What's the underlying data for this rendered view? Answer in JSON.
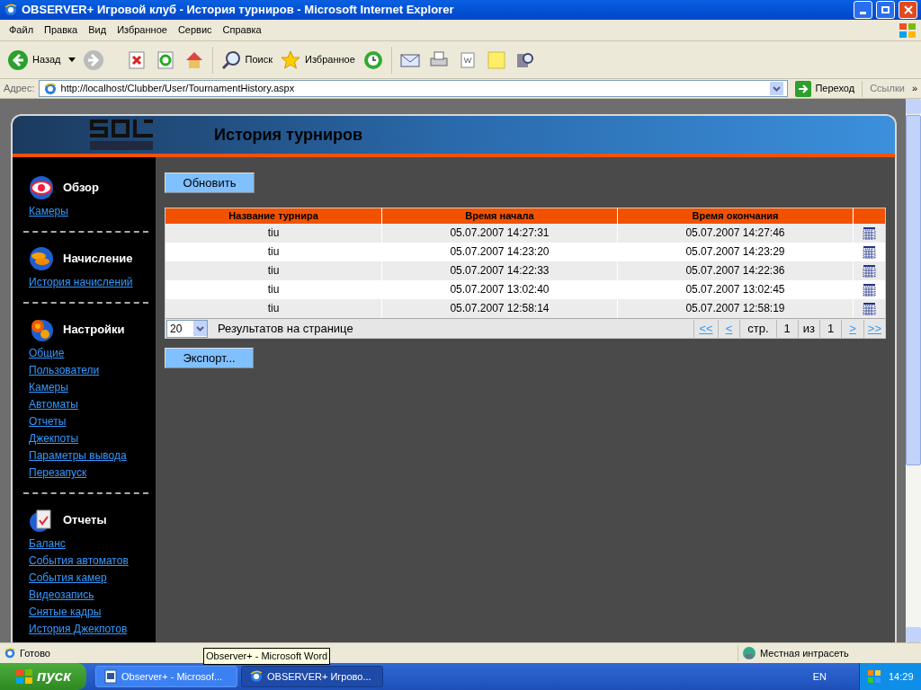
{
  "window": {
    "title": "OBSERVER+ Игровой клуб - История турниров - Microsoft Internet Explorer"
  },
  "menu": [
    "Файл",
    "Правка",
    "Вид",
    "Избранное",
    "Сервис",
    "Справка"
  ],
  "toolbar": {
    "back": "Назад",
    "search": "Поиск",
    "favorites": "Избранное"
  },
  "address": {
    "label": "Адрес:",
    "url": "http://localhost/Clubber/User/TournamentHistory.aspx",
    "go": "Переход",
    "links": "Ссылки",
    "more": "»"
  },
  "page": {
    "title": "История турниров",
    "sidebar": [
      {
        "title": "Обзор",
        "links": [
          "Камеры"
        ]
      },
      {
        "title": "Начисление",
        "links": [
          "История начислений"
        ]
      },
      {
        "title": "Настройки",
        "links": [
          "Общие",
          "Пользователи",
          "Камеры",
          "Автоматы",
          "Отчеты",
          "Джекпоты",
          "Параметры вывода",
          "Перезапуск"
        ]
      },
      {
        "title": "Отчеты",
        "links": [
          "Баланс",
          "События автоматов",
          "События камер",
          "Видеозапись",
          "Снятые кадры",
          "История Джекпотов"
        ]
      }
    ],
    "refresh_button": "Обновить",
    "table": {
      "columns": [
        "Название турнира",
        "Время начала",
        "Время окончания"
      ],
      "rows": [
        {
          "name": "tiu",
          "start": "05.07.2007 14:27:31",
          "end": "05.07.2007 14:27:46"
        },
        {
          "name": "tiu",
          "start": "05.07.2007 14:23:20",
          "end": "05.07.2007 14:23:29"
        },
        {
          "name": "tiu",
          "start": "05.07.2007 14:22:33",
          "end": "05.07.2007 14:22:36"
        },
        {
          "name": "tiu",
          "start": "05.07.2007 13:02:40",
          "end": "05.07.2007 13:02:45"
        },
        {
          "name": "tiu",
          "start": "05.07.2007 12:58:14",
          "end": "05.07.2007 12:58:19"
        }
      ]
    },
    "pager": {
      "page_size": "20",
      "page_size_label": "Результатов на странице",
      "first": "<<",
      "prev": "<",
      "page_label": "стр.",
      "page": "1",
      "of_label": "из",
      "total": "1",
      "next": ">",
      "last": ">>"
    },
    "export_button": "Экспорт..."
  },
  "status_bar": {
    "text": "Готово",
    "zone": "Местная интрасеть"
  },
  "tooltip": "Observer+ - Microsoft Word",
  "taskbar": {
    "start": "пуск",
    "tasks": [
      {
        "label": "Observer+ - Microsof...",
        "selected": false
      },
      {
        "label": "OBSERVER+ Игрово...",
        "selected": true
      }
    ],
    "language": "EN",
    "clock": "14:29"
  }
}
